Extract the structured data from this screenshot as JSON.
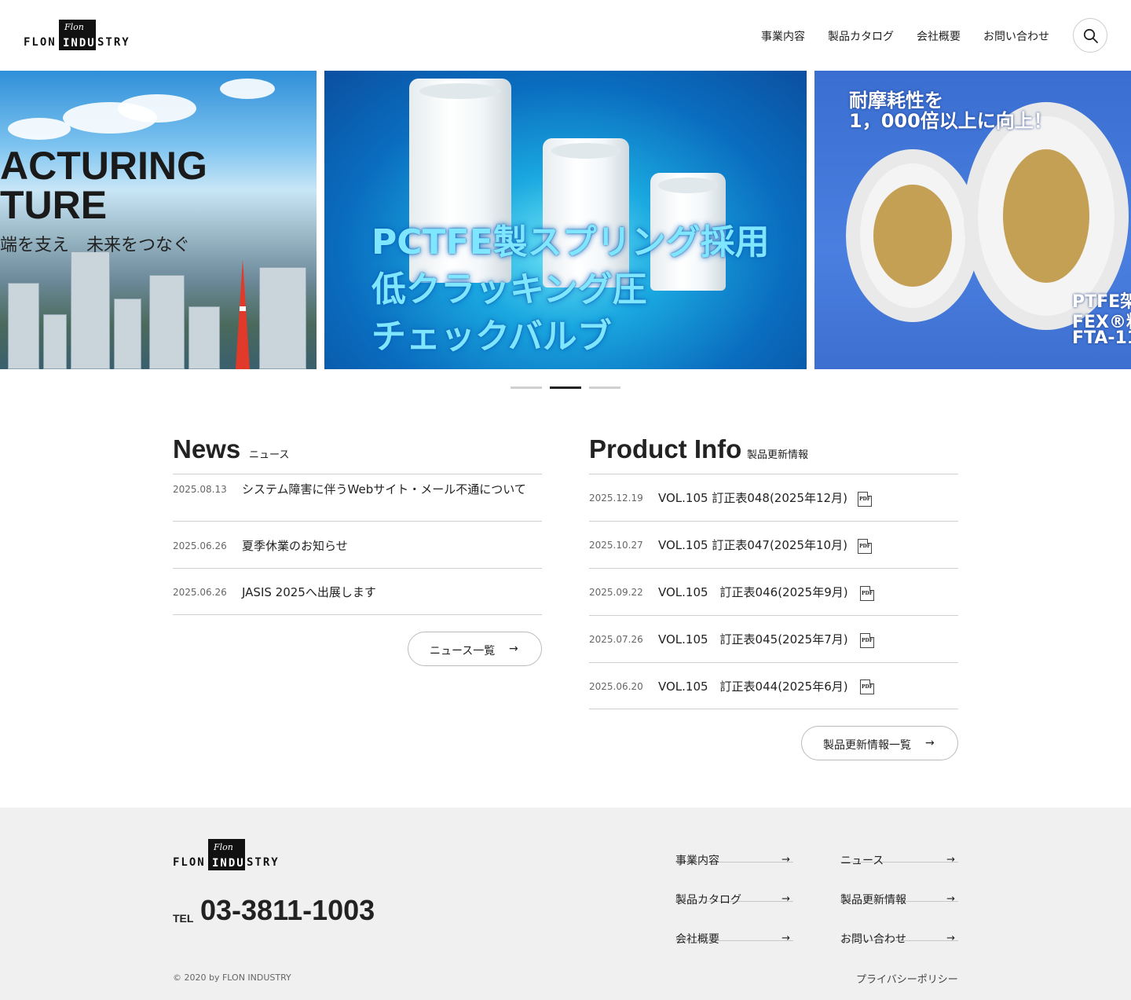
{
  "brand": {
    "logo_left": "FLON",
    "logo_mid": "INDU",
    "logo_right": "STRY",
    "logo_script": "Flon"
  },
  "header": {
    "nav": [
      "事業内容",
      "製品カタログ",
      "会社概要",
      "お問い合わせ"
    ],
    "search_icon": "search-icon"
  },
  "slider": {
    "slide1": {
      "line1": "ACTURING",
      "line2": "TURE",
      "sub": "端を支え　未来をつなぐ"
    },
    "slide2": {
      "line1": "PCTFE製スプリング採用",
      "line2": "低クラッキング圧",
      "line3": "チェックバルブ"
    },
    "slide3": {
      "head1": "耐摩耗性を",
      "head2": "1，000倍以上に向上！",
      "side1": "PTFE架",
      "side2": "FEX®粘",
      "side3": "FTA-11"
    },
    "active_index": 1
  },
  "news": {
    "title": "News",
    "subtitle": "ニュース",
    "items": [
      {
        "date": "2025.08.13",
        "text": "システム障害に伴うWebサイト・メール不通について"
      },
      {
        "date": "2025.06.26",
        "text": "夏季休業のお知らせ"
      },
      {
        "date": "2025.06.26",
        "text": "JASIS 2025へ出展します"
      }
    ],
    "more_label": "ニュース一覧"
  },
  "product": {
    "title": "Product Info",
    "subtitle": "製品更新情報",
    "items": [
      {
        "date": "2025.12.19",
        "text": "VOL.105 訂正表048(2025年12月)"
      },
      {
        "date": "2025.10.27",
        "text": "VOL.105 訂正表047(2025年10月)"
      },
      {
        "date": "2025.09.22",
        "text": "VOL.105　訂正表046(2025年9月)"
      },
      {
        "date": "2025.07.26",
        "text": "VOL.105　訂正表045(2025年7月)"
      },
      {
        "date": "2025.06.20",
        "text": "VOL.105　訂正表044(2025年6月)"
      }
    ],
    "pdf_label": "PDF",
    "more_label": "製品更新情報一覧"
  },
  "footer": {
    "tel_label": "TEL",
    "tel": "03-3811-1003",
    "nav_left": [
      "事業内容",
      "製品カタログ",
      "会社概要"
    ],
    "nav_right": [
      "ニュース",
      "製品更新情報",
      "お問い合わせ"
    ],
    "copyright": "© 2020 by FLON INDUSTRY",
    "privacy": "プライバシーポリシー"
  },
  "arrow_glyph": "→",
  "colors": {
    "accent_dark": "#222222",
    "footer_bg": "#f0f0f0",
    "divider": "#cfcfcf"
  }
}
